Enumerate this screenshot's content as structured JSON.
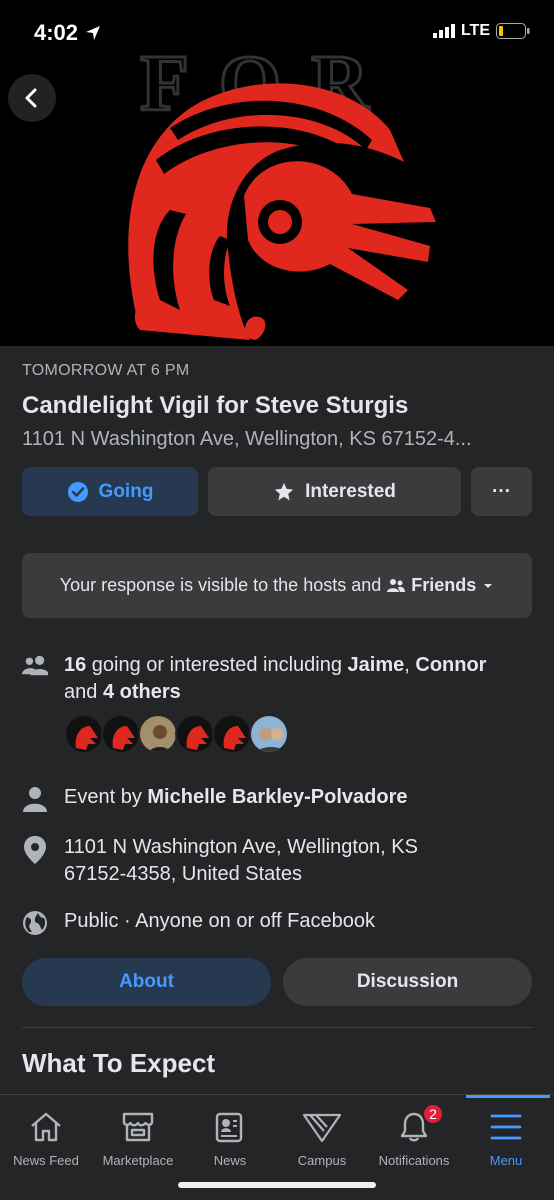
{
  "status_bar": {
    "time": "4:02",
    "network": "LTE"
  },
  "cover": {
    "watermark": "FOR"
  },
  "event": {
    "time": "TOMORROW AT 6 PM",
    "title": "Candlelight Vigil for Steve Sturgis",
    "address_short": "1101 N Washington Ave, Wellington, KS 67152-4..."
  },
  "actions": {
    "going": "Going",
    "interested": "Interested",
    "more": "···"
  },
  "visibility": {
    "text": "Your response is visible to the hosts and",
    "audience": "Friends"
  },
  "attendance": {
    "count": "16",
    "text_mid": " going or interested including ",
    "name1": "Jaime",
    "sep": ", ",
    "name2": "Connor",
    "text_and": "and ",
    "others": "4 others"
  },
  "host": {
    "prefix": "Event by ",
    "name": "Michelle Barkley-Polvadore"
  },
  "location": {
    "line1": "1101 N Washington Ave, Wellington, KS",
    "line2": "67152-4358, United States"
  },
  "privacy": {
    "text": "Public · Anyone on or off Facebook"
  },
  "tabs": {
    "about": "About",
    "discussion": "Discussion"
  },
  "section": {
    "title": "What To Expect"
  },
  "nav": {
    "items": [
      {
        "label": "News Feed",
        "icon": "home-icon"
      },
      {
        "label": "Marketplace",
        "icon": "store-icon"
      },
      {
        "label": "News",
        "icon": "news-icon"
      },
      {
        "label": "Campus",
        "icon": "campus-icon"
      },
      {
        "label": "Notifications",
        "icon": "bell-icon",
        "badge": "2"
      },
      {
        "label": "Menu",
        "icon": "menu-icon"
      }
    ]
  },
  "colors": {
    "accent": "#4599ff",
    "background": "#242526",
    "surface": "#3a3b3c",
    "cover_red": "#e0281e",
    "badge": "#e41e3f"
  }
}
